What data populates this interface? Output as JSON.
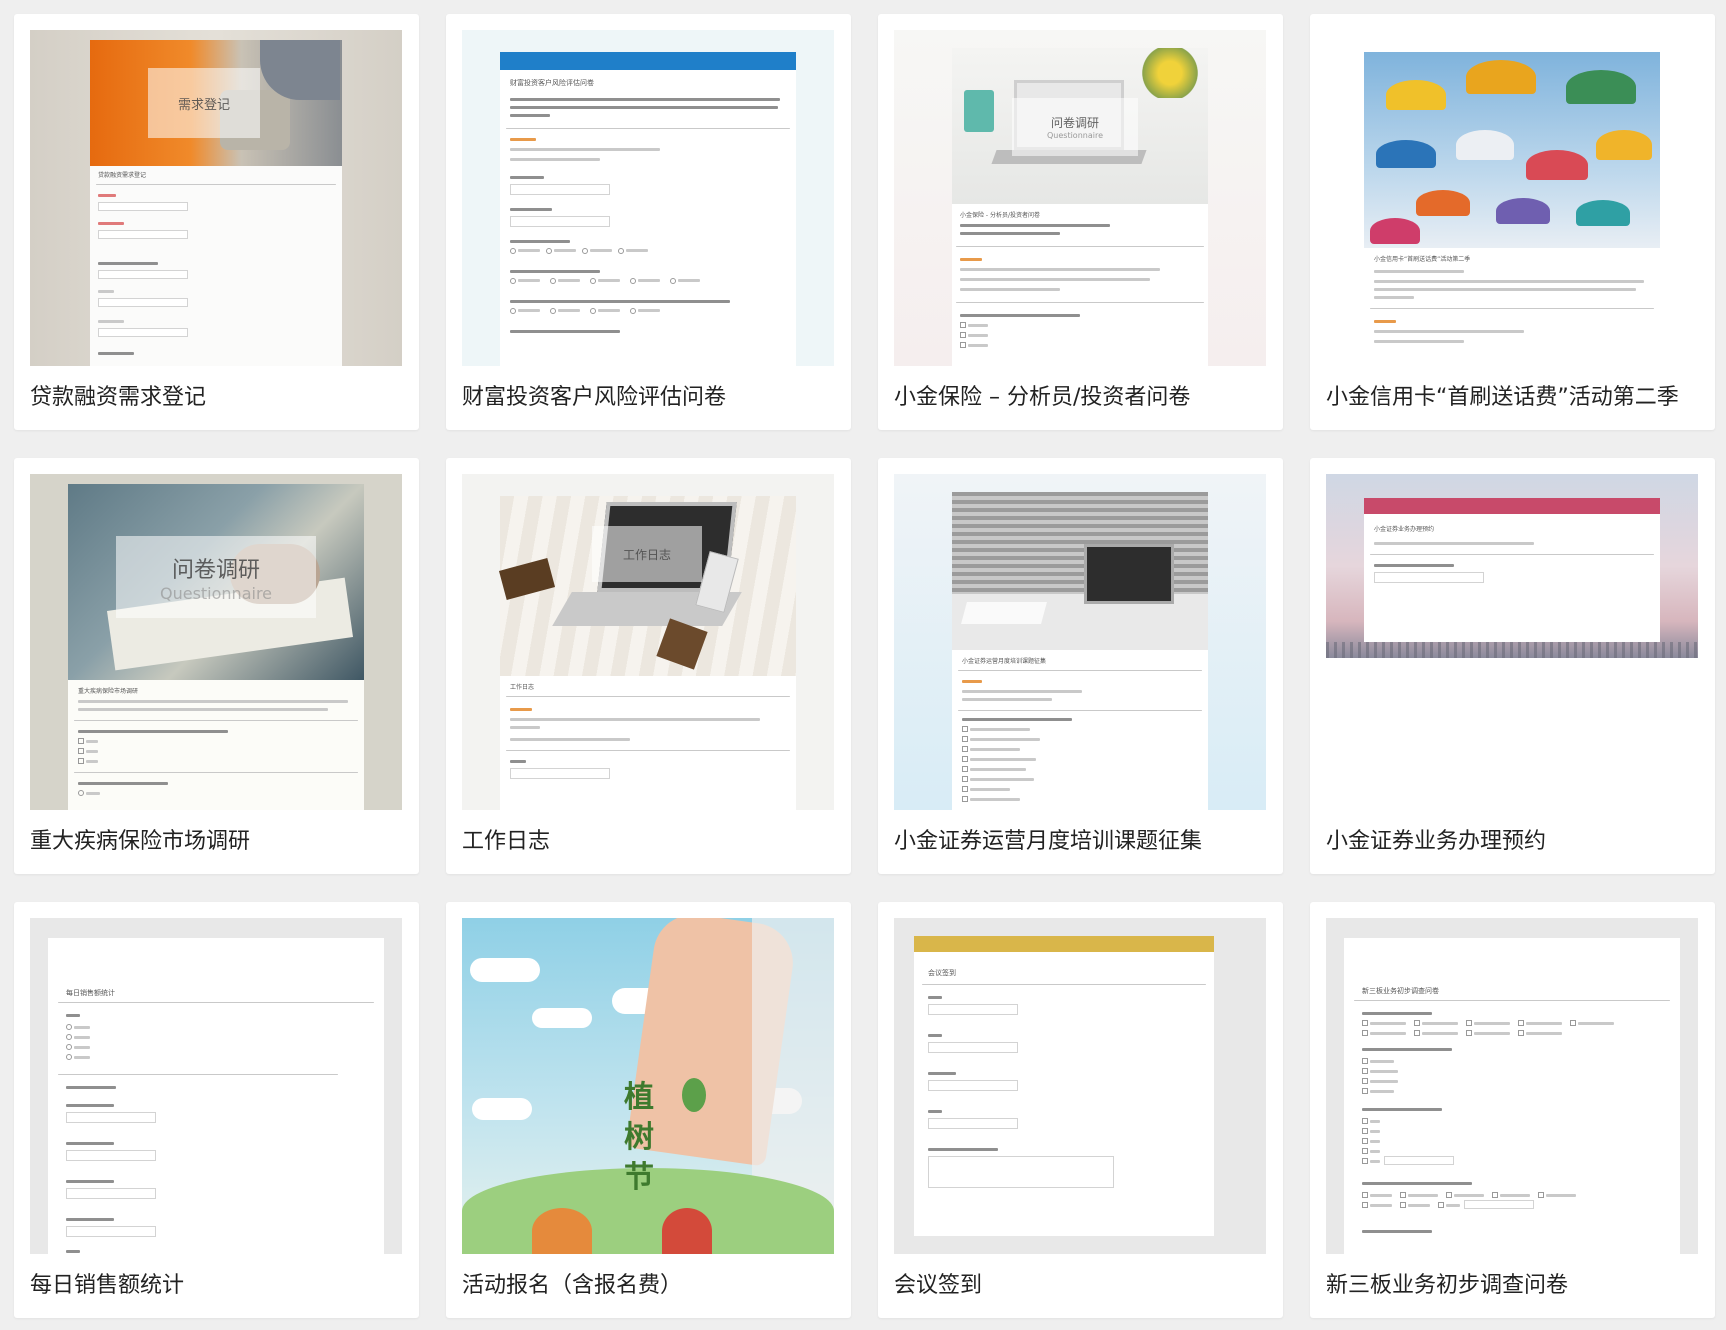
{
  "templates": [
    {
      "title": "贷款融资需求登记",
      "preview_heading": "需求登记",
      "preview_form_title": "贷款融资需求登记"
    },
    {
      "title": "财富投资客户风险评估问卷",
      "preview_form_title": "财富投资客户风险评估问卷"
    },
    {
      "title": "小金保险 – 分析员/投资者问卷",
      "preview_heading": "问卷调研",
      "preview_subheading": "Questionnaire",
      "preview_form_title": "小金保险 - 分析员/投资者问卷"
    },
    {
      "title": "小金信用卡“首刷送话费”活动第二季",
      "preview_form_title": "小金信用卡“首刷送话费”活动第二季"
    },
    {
      "title": "重大疾病保险市场调研",
      "preview_heading": "问卷调研",
      "preview_subheading": "Questionnaire",
      "preview_form_title": "重大疾病保险市场调研"
    },
    {
      "title": "工作日志",
      "preview_heading": "工作日志",
      "preview_form_title": "工作日志"
    },
    {
      "title": "小金证券运营月度培训课题征集",
      "preview_form_title": "小金证券运营月度培训课题征集"
    },
    {
      "title": "小金证券业务办理预约",
      "preview_form_title": "小金证券业务办理预约"
    },
    {
      "title": "每日销售额统计",
      "preview_form_title": "每日销售额统计"
    },
    {
      "title": "活动报名（含报名费）",
      "preview_heading": "植树节"
    },
    {
      "title": "会议签到",
      "preview_form_title": "会议签到"
    },
    {
      "title": "新三板业务初步调查问卷",
      "preview_form_title": "新三板业务初步调查问卷"
    }
  ],
  "colors": {
    "page_bg": "#efefef",
    "card_bg": "#ffffff",
    "blue_header": "#1f7fc9",
    "red_header": "#c84a6a",
    "gold_header": "#d9b64a"
  }
}
